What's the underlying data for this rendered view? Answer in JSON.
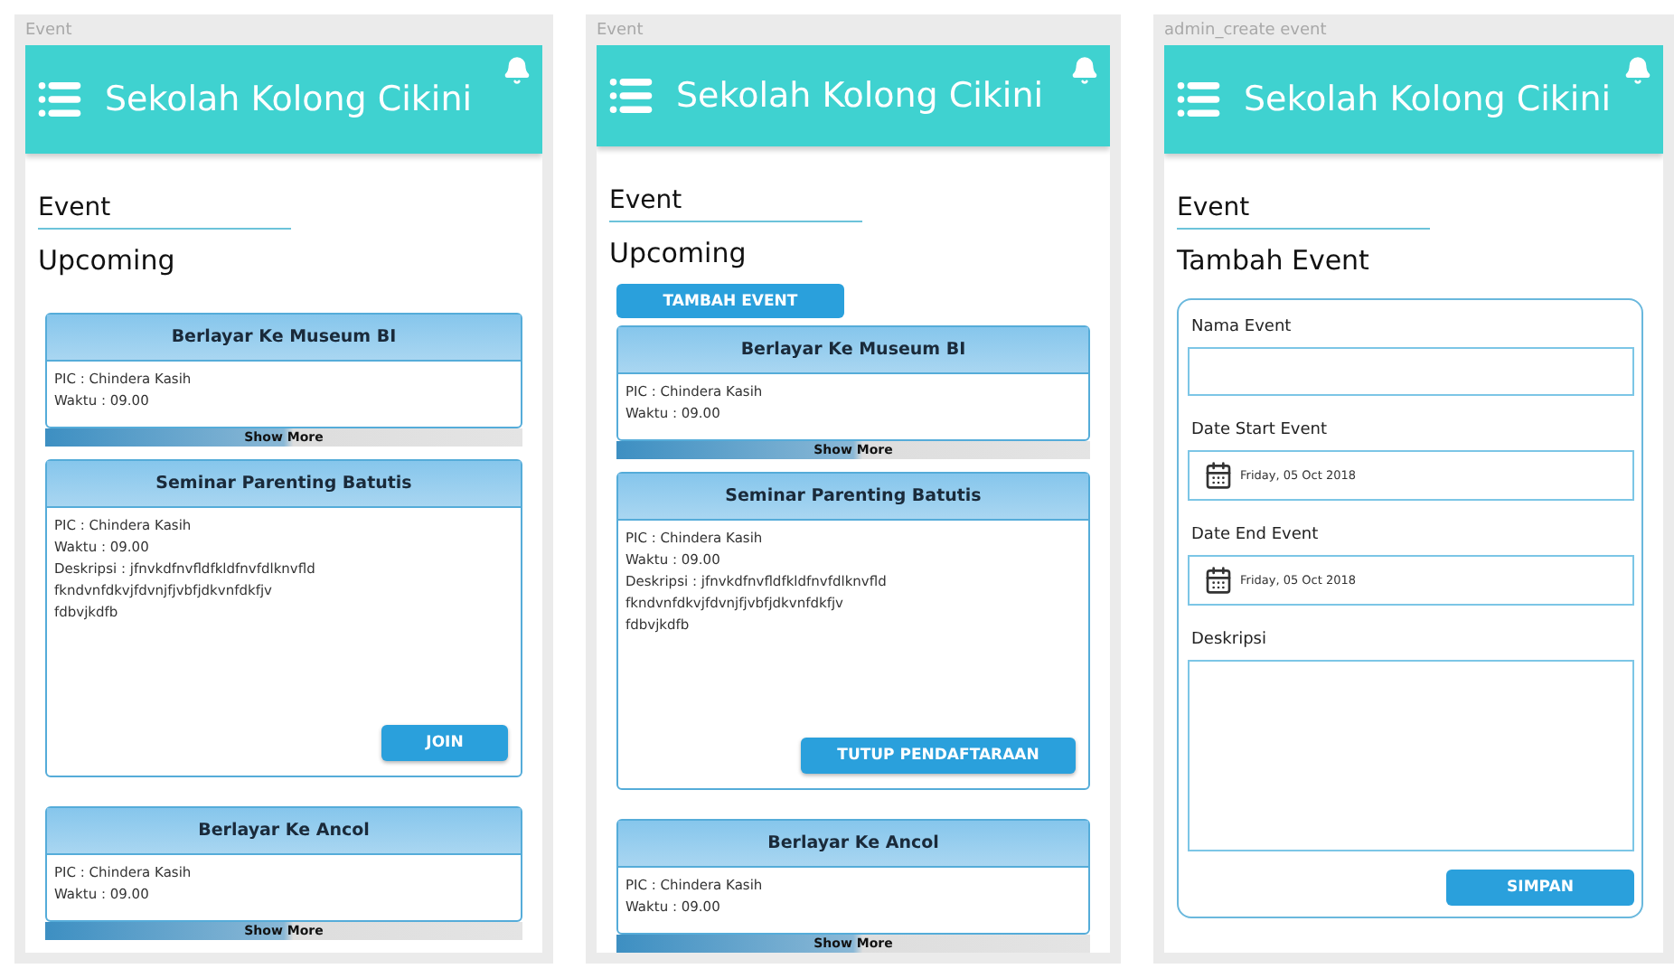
{
  "frames": [
    {
      "kind": "list",
      "label": "Event",
      "header": {
        "title": "Sekolah Kolong Cikini"
      },
      "section_title": "Event",
      "subtitle": "Upcoming",
      "events": [
        {
          "kind": "collapsed",
          "title": "Berlayar Ke Museum BI",
          "pic": "PIC : Chindera Kasih",
          "time": "Waktu : 09.00",
          "action": "Show More"
        },
        {
          "kind": "expanded",
          "title": "Seminar Parenting Batutis",
          "pic": "PIC : Chindera Kasih",
          "time": "Waktu : 09.00",
          "description": [
            "Deskripsi : jfnvkdfnvfldfkldfnvfdlknvfld",
            "fkndvnfdkvjfdvnjfjvbfjdkvnfdkfjv",
            "fdbvjkdfb"
          ],
          "action": "JOIN"
        },
        {
          "kind": "collapsed",
          "title": "Berlayar Ke Ancol",
          "pic": "PIC : Chindera Kasih",
          "time": "Waktu : 09.00",
          "action": "Show More"
        }
      ]
    },
    {
      "kind": "list",
      "label": "Event",
      "header": {
        "title": "Sekolah Kolong Cikini"
      },
      "section_title": "Event",
      "subtitle": "Upcoming",
      "add_button": "TAMBAH EVENT",
      "events": [
        {
          "kind": "collapsed",
          "title": "Berlayar Ke Museum BI",
          "pic": "PIC : Chindera Kasih",
          "time": "Waktu : 09.00",
          "action": "Show More"
        },
        {
          "kind": "expanded",
          "title": "Seminar Parenting Batutis",
          "pic": "PIC : Chindera Kasih",
          "time": "Waktu : 09.00",
          "description": [
            "Deskripsi : jfnvkdfnvfldfkldfnvfdlknvfld",
            "fkndvnfdkvjfdvnjfjvbfjdkvnfdkfjv",
            "fdbvjkdfb"
          ],
          "action": "TUTUP PENDAFTARAAN"
        },
        {
          "kind": "collapsed",
          "title": "Berlayar Ke Ancol",
          "pic": "PIC : Chindera Kasih",
          "time": "Waktu : 09.00",
          "action": "Show More"
        }
      ]
    },
    {
      "kind": "form",
      "label": "admin_create event",
      "header": {
        "title": "Sekolah Kolong Cikini"
      },
      "section_title": "Event",
      "subtitle": "Tambah Event",
      "fields": [
        {
          "kind": "text",
          "label": "Nama Event"
        },
        {
          "kind": "date",
          "label": "Date Start Event",
          "value": "Friday, 05 Oct 2018"
        },
        {
          "kind": "date",
          "label": "Date End Event",
          "value": "Friday, 05 Oct 2018"
        },
        {
          "kind": "textarea",
          "label": "Deskripsi"
        }
      ],
      "submit": "SIMPAN"
    }
  ]
}
